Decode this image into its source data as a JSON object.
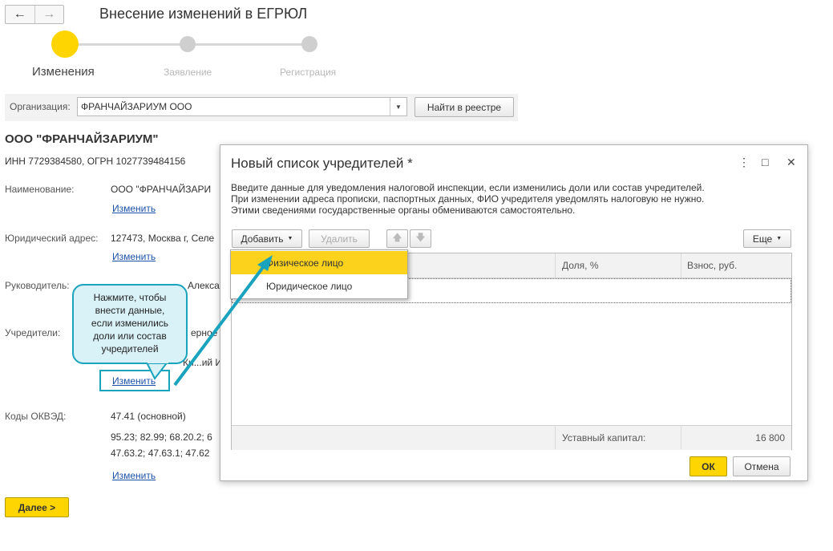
{
  "window": {
    "title": "Внесение изменений в ЕГРЮЛ"
  },
  "steps": [
    {
      "label": "Изменения",
      "active": true
    },
    {
      "label": "Заявление",
      "active": false
    },
    {
      "label": "Регистрация",
      "active": false
    }
  ],
  "org": {
    "label": "Организация:",
    "value": "ФРАНЧАЙЗАРИУМ ООО",
    "registry_button": "Найти в реестре"
  },
  "company": {
    "name": "ООО \"ФРАНЧАЙЗАРИУМ\"",
    "ids": "ИНН 7729384580, ОГРН 1027739484156",
    "rows": {
      "name": {
        "label": "Наименование:",
        "value": "ООО \"ФРАНЧАЙЗАРИ",
        "link": "Изменить"
      },
      "address": {
        "label": "Юридический адрес:",
        "value": "127473, Москва г, Селе",
        "link": "Изменить"
      },
      "director": {
        "label": "Руководитель:",
        "value": "Алекса"
      },
      "founders": {
        "label": "Учредители:",
        "value1": "ерное",
        "value2": "Ки...ий Иос",
        "link": "Изменить"
      },
      "okved": {
        "label": "Коды ОКВЭД:",
        "main": "47.41 (основной)",
        "line2": "95.23; 82.99; 68.20.2; 6",
        "line3": "47.63.2; 47.63.1; 47.62",
        "link": "Изменить"
      }
    }
  },
  "next_button": "Далее >",
  "dialog": {
    "title": "Новый список учредителей *",
    "controls": {
      "more": "⋮",
      "maximize": "□",
      "close": "✕"
    },
    "description": [
      "Введите данные для уведомления налоговой инспекции, если изменились доли или состав учредителей.",
      "При изменении адреса прописки, паспортных данных, ФИО учредителя уведомлять налоговую не нужно.",
      "Этими сведениями государственные органы обмениваются самостоятельно."
    ],
    "toolbar": {
      "add": "Добавить",
      "delete": "Удалить",
      "more": "Еще"
    },
    "table": {
      "columns": [
        "Доля, %",
        "Взнос, руб."
      ],
      "footer_label": "Уставный капитал:",
      "footer_value": "16 800"
    },
    "ok": "ОК",
    "cancel": "Отмена"
  },
  "add_menu": {
    "items": [
      "Физическое лицо",
      "Юридическое лицо"
    ]
  },
  "callout": {
    "lines": [
      "Нажмите, чтобы",
      "внести данные,",
      "если изменились",
      "доли или состав",
      "учредителей"
    ]
  },
  "colors": {
    "accent": "#ffd500",
    "link": "#1c52a8",
    "callout_border": "#1aa3bd",
    "callout_fill": "#d9f2f8",
    "menu_highlight": "#fcd21d"
  }
}
